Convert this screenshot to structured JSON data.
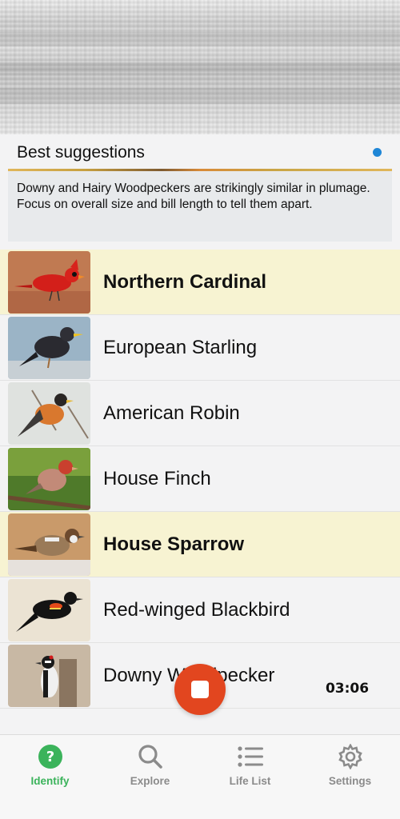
{
  "suggestions": {
    "title": "Best suggestions",
    "tip": "Downy and Hairy Woodpeckers are strikingly similar in plumage. Focus on overall size and bill length to tell them apart."
  },
  "birds": [
    {
      "name": "Northern Cardinal",
      "highlighted": true
    },
    {
      "name": "European Starling",
      "highlighted": false
    },
    {
      "name": "American Robin",
      "highlighted": false
    },
    {
      "name": "House Finch",
      "highlighted": false
    },
    {
      "name": "House Sparrow",
      "highlighted": true
    },
    {
      "name": "Red-winged Blackbird",
      "highlighted": false
    },
    {
      "name": "Downy Woodpecker",
      "highlighted": false
    }
  ],
  "recording": {
    "timer": "03:06"
  },
  "tabs": [
    {
      "label": "Identify",
      "icon": "question-circle-icon",
      "active": true
    },
    {
      "label": "Explore",
      "icon": "search-icon",
      "active": false
    },
    {
      "label": "Life List",
      "icon": "list-icon",
      "active": false
    },
    {
      "label": "Settings",
      "icon": "gear-icon",
      "active": false
    }
  ],
  "colors": {
    "accent_green": "#3bb35b",
    "stop_red": "#e2461f",
    "highlight": "#f7f3d2",
    "dot_blue": "#1f86d6"
  }
}
